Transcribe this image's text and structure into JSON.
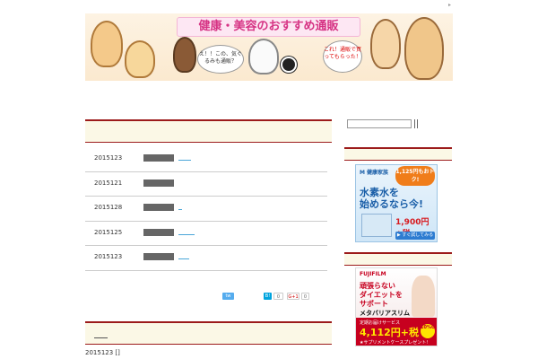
{
  "header": {
    "title": "健康・美容のおすすめ通販",
    "bubble_left": "え！！この、気ぐるみも通販？",
    "bubble_right": "これ！通販で買ってもらった！",
    "corner_mark": "▸"
  },
  "posts": [
    {
      "date": "2015123",
      "link_width": 14
    },
    {
      "date": "2015121",
      "link_width": 0
    },
    {
      "date": "2015128",
      "link_width": 4
    },
    {
      "date": "2015125",
      "link_width": 18
    },
    {
      "date": "2015123",
      "link_width": 12
    }
  ],
  "share": {
    "twitter": "tw",
    "hatena": "B!",
    "hatena_count": "0",
    "gplus": "G+1",
    "gplus_count": "0"
  },
  "footer": {
    "date_line": "2015123 []"
  },
  "sidebar": {
    "search_placeholder": "",
    "ads": {
      "water": {
        "brand": "M 健康家族",
        "badge": "1,125円もおトク!",
        "line1": "水素水を",
        "line2": "始めるなら今!",
        "price": "1,900円+税",
        "button": "▶ すぐ試してみる"
      },
      "fujifilm": {
        "brand": "FUJIFILM",
        "line1": "頑張らない",
        "line2": "ダイエットを",
        "line3": "サポート",
        "product": "メタバリアスリム",
        "sub": "定期お届けサービス",
        "price": "4,112円+税",
        "gift": "★サプリメントケースプレゼント!",
        "badge": "10%OFF"
      }
    }
  },
  "colors": {
    "accent": "#9c1b1b",
    "header_bg": "#fbf8e6",
    "link": "#4aa6d8"
  }
}
